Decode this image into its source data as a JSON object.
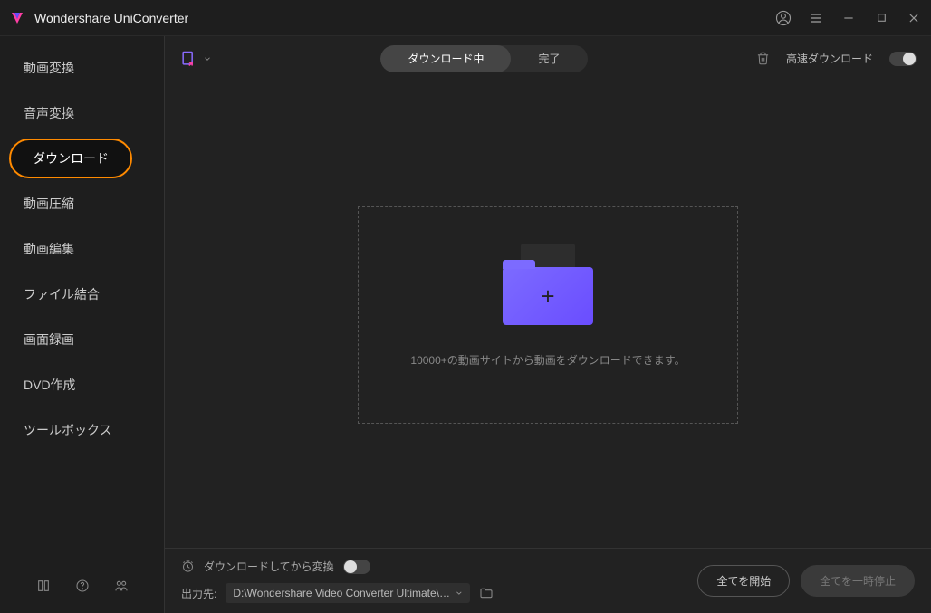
{
  "title": "Wondershare UniConverter",
  "sidebar": {
    "items": [
      {
        "label": "動画変換"
      },
      {
        "label": "音声変換"
      },
      {
        "label": "ダウンロード"
      },
      {
        "label": "動画圧縮"
      },
      {
        "label": "動画編集"
      },
      {
        "label": "ファイル結合"
      },
      {
        "label": "画面録画"
      },
      {
        "label": "DVD作成"
      },
      {
        "label": "ツールボックス"
      }
    ],
    "active_index": 2
  },
  "toolbar": {
    "tabs": {
      "downloading": "ダウンロード中",
      "completed": "完了"
    },
    "speed_label": "高速ダウンロード"
  },
  "dropzone": {
    "text": "10000+の動画サイトから動画をダウンロードできます。"
  },
  "footer": {
    "convert_after_download": "ダウンロードしてから変換",
    "output_label": "出力先:",
    "output_path": "D:\\Wondershare Video Converter Ultimate\\Dow",
    "start_all": "全てを開始",
    "pause_all": "全てを一時停止"
  }
}
